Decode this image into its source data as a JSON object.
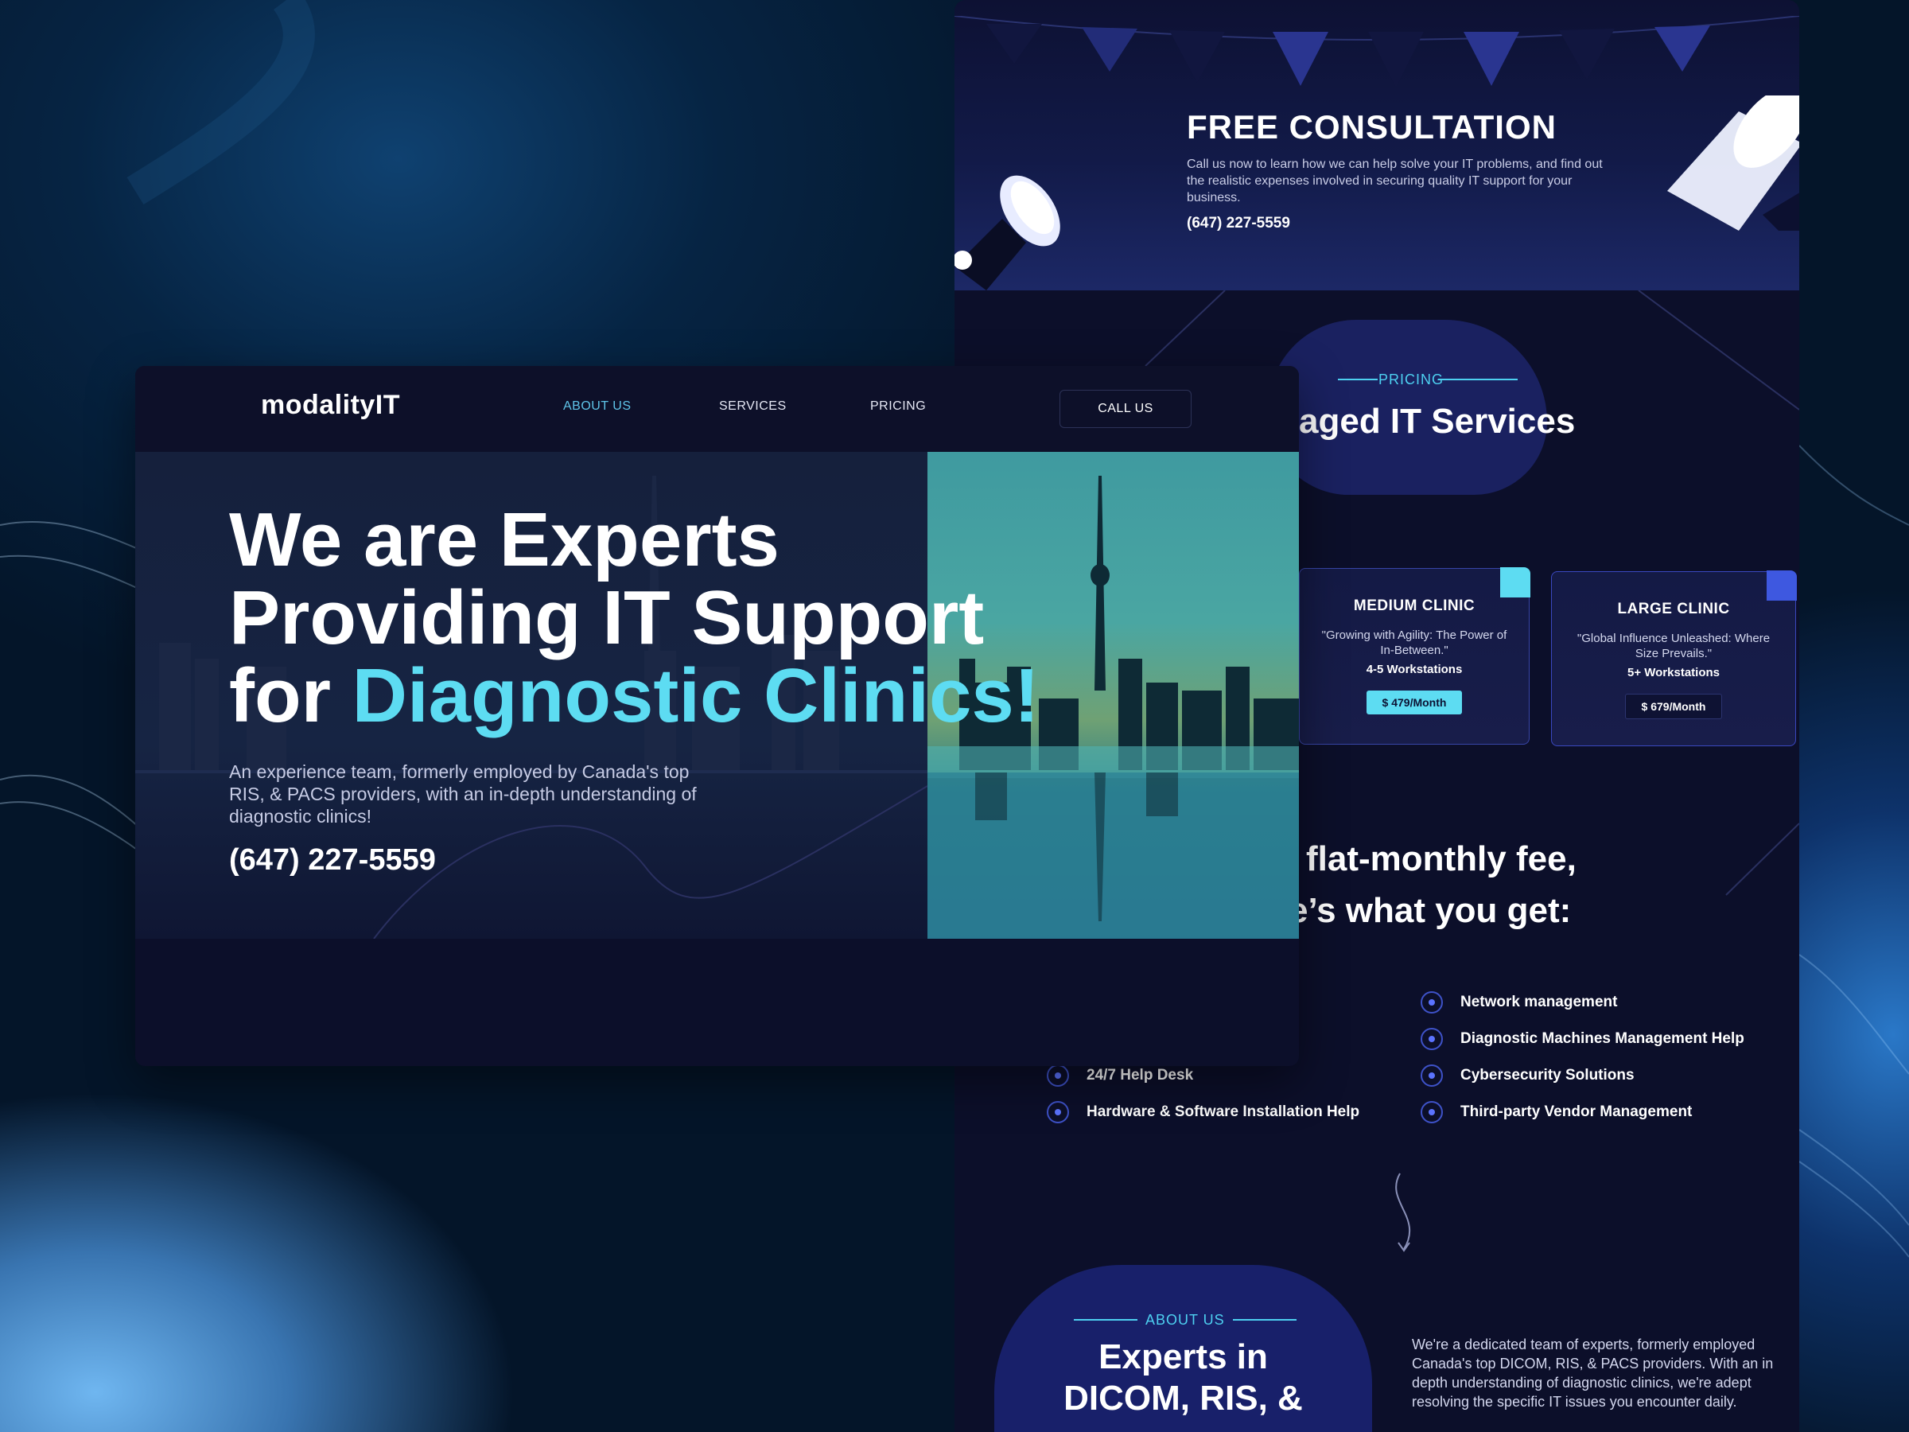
{
  "colors": {
    "accent_cyan": "#5ddcf2",
    "indigo": "#3846a8",
    "page_bg": "#0c0f2a"
  },
  "consultation": {
    "title": "FREE CONSULTATION",
    "text": "Call us now to learn how we can help solve your IT problems, and find out the realistic expenses involved in securing quality IT support for your business.",
    "phone": "(647) 227-5559",
    "icon": "megaphone-icon"
  },
  "pricing": {
    "eyebrow": "PRICING",
    "heading": "aged IT Services",
    "plans": [
      {
        "name": "MEDIUM CLINIC",
        "quote": "\"Growing with Agility: The Power of In-Between.\"",
        "workstations": "4-5 Workstations",
        "price": "$ 479/Month",
        "highlight": true
      },
      {
        "name": "LARGE CLINIC",
        "quote": "\"Global Influence Unleashed: Where Size Prevails.\"",
        "workstations": "5+ Workstations",
        "price": "$ 679/Month",
        "highlight": false
      }
    ]
  },
  "fee": {
    "line1": "flat-monthly fee,",
    "line2": "e’s what you get:"
  },
  "features": {
    "right": [
      "Network management",
      "Diagnostic Machines Management Help",
      "Cybersecurity Solutions",
      "Third-party Vendor Management"
    ],
    "left": [
      "24/7 Help Desk",
      "Hardware & Software Installation Help"
    ]
  },
  "about": {
    "eyebrow": "ABOUT US",
    "heading_line1": "Experts in",
    "heading_line2": "DICOM, RIS, &",
    "text": "We're a dedicated team of experts, formerly employed Canada's top DICOM, RIS, & PACS providers. With an in depth understanding of diagnostic clinics, we're adept resolving the specific IT issues you encounter daily."
  },
  "nav": {
    "logo": "modalityIT",
    "items": [
      "ABOUT US",
      "SERVICES",
      "PRICING"
    ],
    "active_index": 0,
    "cta": "CALL US"
  },
  "hero": {
    "title_line1": "We are Experts",
    "title_line2": "Providing IT Support",
    "title_line3_prefix": "for ",
    "title_line3_accent": "Diagnostic Clinics!",
    "subtitle": "An experience team, formerly employed by Canada's top RIS, & PACS providers, with an in-depth understanding of diagnostic clinics!",
    "phone": "(647) 227-5559"
  }
}
